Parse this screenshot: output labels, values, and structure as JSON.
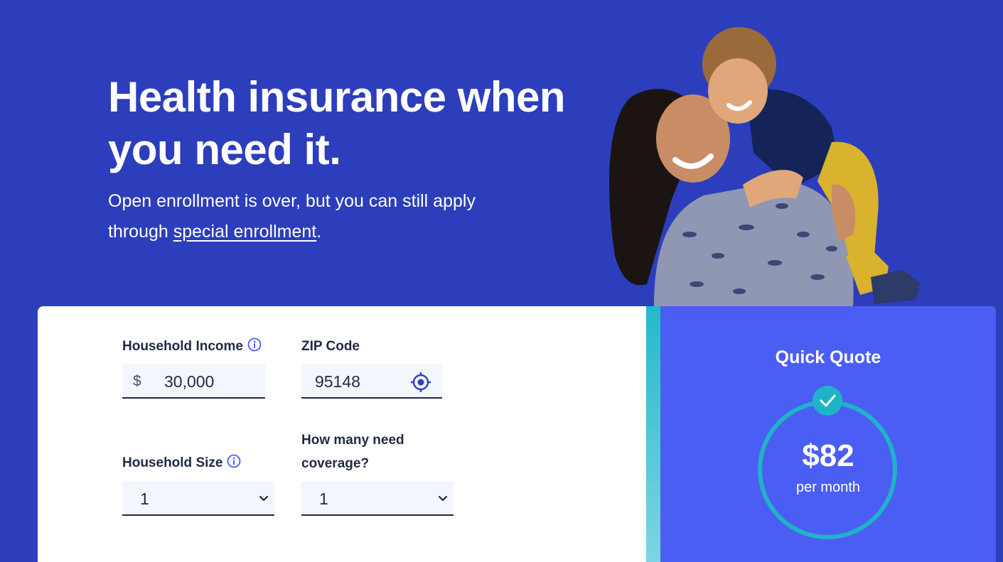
{
  "hero": {
    "title": "Health insurance when you need it.",
    "subtitle_before": "Open enrollment is over, but you can still apply through ",
    "subtitle_link": "special enrollment",
    "subtitle_after": "."
  },
  "form": {
    "income": {
      "label": "Household Income",
      "prefix": "$",
      "value": "30,000",
      "icon": "info-icon"
    },
    "zip": {
      "label": "ZIP Code",
      "value": "95148",
      "icon": "locate-icon"
    },
    "size": {
      "label": "Household Size",
      "value": "1",
      "icon": "info-icon"
    },
    "coverage": {
      "label": "How many need coverage?",
      "value": "1"
    }
  },
  "quote": {
    "title": "Quick Quote",
    "amount": "$82",
    "unit": "per month",
    "icon": "check-icon"
  },
  "colors": {
    "background": "#2c3ebc",
    "quote_panel": "#4b5ef4",
    "accent": "#1fb3c8",
    "text_dark": "#1f2a44"
  }
}
